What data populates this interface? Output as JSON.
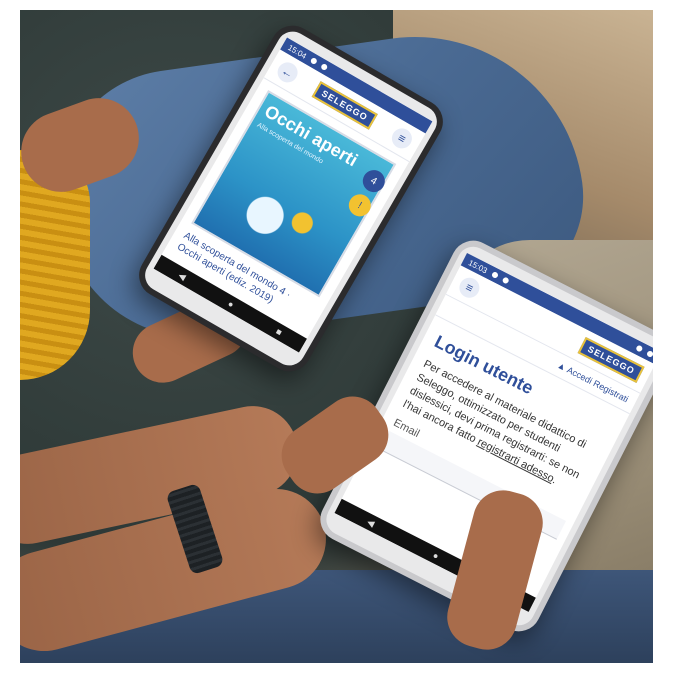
{
  "tablet_back": {
    "status_time": "15:04",
    "logo": "SELEGGO",
    "book_title": "Occhi aperti",
    "book_subtitle": "Alla scoperta del mondo",
    "caption": "Alla scoperta del mondo 4 · Occhi aperti (ediz. 2019)",
    "badge": "4",
    "nav_icons": [
      "back-icon",
      "home-icon",
      "recent-icon"
    ]
  },
  "tablet_front": {
    "status_time": "15:03",
    "logo": "SELEGGO",
    "nav_link": "Accedi Registrati",
    "title": "Login utente",
    "paragraph_before_link": "Per accedere al materiale didattico di Seleggo, ottimizzato per studenti dislessici, devi prima registrarti: se non l'hai ancora fatto ",
    "link_text": "registrarti adesso",
    "paragraph_after_link": ".",
    "email_label": "Email",
    "email_value": ""
  },
  "colors": {
    "brand_blue": "#2f4f9a",
    "brand_yellow": "#e9c23a"
  }
}
